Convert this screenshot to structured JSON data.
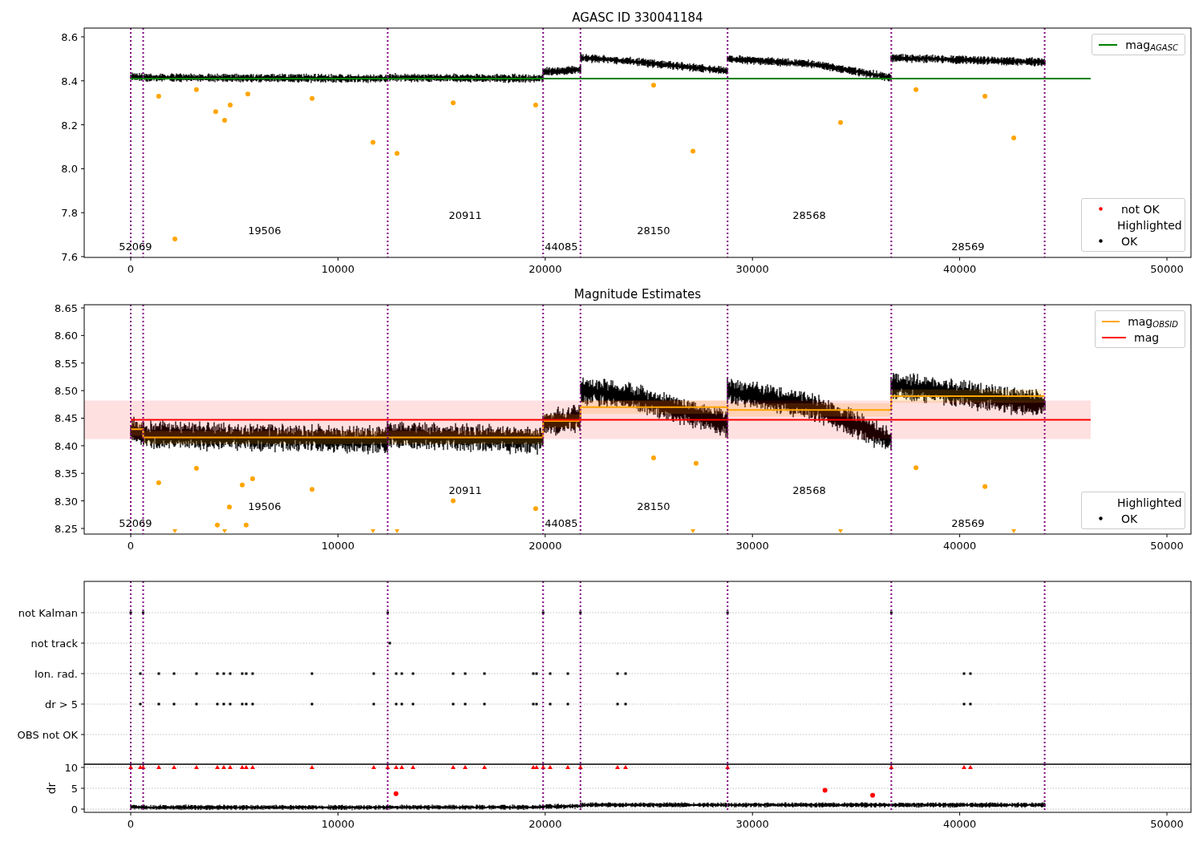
{
  "figure": {
    "panels": [
      {
        "chart_data": {
          "type": "scatter",
          "title": "AGASC ID 330041184",
          "xlim": [
            -2245,
            51160
          ],
          "ylim": [
            7.5964,
            8.64
          ],
          "xticks": [
            0,
            10000,
            20000,
            30000,
            40000,
            50000
          ],
          "yticks": [
            {
              "value": 7.6,
              "label": "7.6"
            },
            {
              "value": 7.8,
              "label": "7.8"
            },
            {
              "value": 8.0,
              "label": "8.0"
            },
            {
              "value": 8.2,
              "label": "8.2"
            },
            {
              "value": 8.4,
              "label": "8.4"
            },
            {
              "value": 8.6,
              "label": "8.6"
            }
          ],
          "series": [
            {
              "name": "mag$_{AGASC}$",
              "type": "line",
              "color": "#008000",
              "x": [
                0,
                46320
              ],
              "values": [
                8.41,
                8.41
              ]
            },
            {
              "name": "not OK",
              "type": "scatter",
              "color": "#ff0000"
            },
            {
              "name": "Highlighted",
              "type": "scatter",
              "color": "#ffa500",
              "x": [
                2130,
                4100,
                4530,
                4800,
                5650,
                11690,
                12850,
                15560,
                19540,
                27130,
                34250,
                41220,
                42610,
                1350,
                3170,
                8750,
                25230,
                37890
              ],
              "values": [
                7.68,
                8.26,
                8.22,
                8.29,
                8.34,
                8.12,
                8.07,
                8.3,
                8.29,
                8.08,
                8.21,
                8.33,
                8.14,
                8.33,
                8.36,
                8.32,
                8.38,
                8.36
              ]
            },
            {
              "name": "OK",
              "type": "scatter",
              "color": "#000000"
            }
          ],
          "ref_lines": [
            {
              "axis": "x",
              "value": 0
            },
            {
              "axis": "x",
              "value": 600
            },
            {
              "axis": "x",
              "value": 12400
            },
            {
              "axis": "x",
              "value": 19900
            },
            {
              "axis": "x",
              "value": 21700
            },
            {
              "axis": "x",
              "value": 28800
            },
            {
              "axis": "x",
              "value": 36700
            },
            {
              "axis": "x",
              "value": 44100
            }
          ],
          "annotations": [
            "52069",
            "19506",
            "20911",
            "44085",
            "28150",
            "28568",
            "28569"
          ]
        }
      },
      {
        "chart_data": {
          "type": "scatter",
          "title": "Magnitude Estimates",
          "xlim": [
            -2245,
            51160
          ],
          "ylim": [
            8.2398,
            8.6558
          ],
          "xticks": [
            0,
            10000,
            20000,
            30000,
            40000,
            50000
          ],
          "yticks": [
            {
              "value": 8.25,
              "label": "8.25"
            },
            {
              "value": 8.3,
              "label": "8.30"
            },
            {
              "value": 8.35,
              "label": "8.35"
            },
            {
              "value": 8.4,
              "label": "8.40"
            },
            {
              "value": 8.45,
              "label": "8.45"
            },
            {
              "value": 8.5,
              "label": "8.50"
            },
            {
              "value": 8.55,
              "label": "8.55"
            },
            {
              "value": 8.6,
              "label": "8.60"
            },
            {
              "value": 8.65,
              "label": "8.65"
            }
          ],
          "series": [
            {
              "name": "mag$_{OBSID}$",
              "type": "step",
              "color": "#ffa500",
              "x": [
                0,
                600,
                12400,
                19900,
                21700,
                28800,
                36700,
                44100
              ],
              "values": [
                8.43,
                8.415,
                8.415,
                8.445,
                8.47,
                8.465,
                8.49,
                8.49
              ]
            },
            {
              "name": "mag",
              "type": "line",
              "color": "#ff0000",
              "x": [
                0,
                46320
              ],
              "values": [
                8.447,
                8.447
              ]
            },
            {
              "name": "Highlighted",
              "type": "scatter",
              "color": "#ffa500",
              "x": [
                1350,
                3170,
                5380,
                5880,
                8750,
                15560,
                19540,
                4760,
                4180,
                5570,
                25230,
                27280,
                37890,
                41220
              ],
              "values": [
                8.333,
                8.359,
                8.329,
                8.34,
                8.321,
                8.3,
                8.286,
                8.289,
                8.256,
                8.256,
                8.378,
                8.368,
                8.36,
                8.326
              ]
            },
            {
              "name": "OK",
              "type": "scatter",
              "color": "#000000"
            }
          ],
          "bands": [
            {
              "axis": "y",
              "from": 8.412,
              "to": 8.482,
              "color": "#ff0000"
            }
          ],
          "ref_lines": [
            {
              "axis": "x",
              "value": 0
            },
            {
              "axis": "x",
              "value": 600
            },
            {
              "axis": "x",
              "value": 12400
            },
            {
              "axis": "x",
              "value": 19900
            },
            {
              "axis": "x",
              "value": 21700
            },
            {
              "axis": "x",
              "value": 28800
            },
            {
              "axis": "x",
              "value": 36700
            },
            {
              "axis": "x",
              "value": 44100
            }
          ],
          "annotations": [
            "52069",
            "19506",
            "20911",
            "44085",
            "28150",
            "28568",
            "28569"
          ]
        }
      },
      {
        "flags": [
          "not Kalman",
          "not track",
          "Ion. rad.",
          "dr > 5",
          "OBS not OK"
        ]
      },
      {
        "chart_data": {
          "type": "scatter",
          "grid": true,
          "ylabel": "dr",
          "xlim": [
            -2245,
            51160
          ],
          "ylim": [
            -0.77,
            10.77
          ],
          "xticks": [
            0,
            10000,
            20000,
            30000,
            40000,
            50000
          ],
          "yticks": [
            0,
            5,
            10
          ],
          "series": [
            {
              "color": "#ff0000",
              "x": [
                0,
                464,
                600,
                1354,
                2090,
                3173,
                4180,
                4489,
                4799,
                5379,
                5573,
                5882,
                8746,
                11726,
                12400,
                12810,
                13080,
                13622,
                15557,
                16138,
                17067,
                19427,
                19582,
                19900,
                20240,
                21091,
                21700,
                23491,
                23878,
                28800,
                36700,
                40209,
                40518
              ],
              "values": [
                10,
                10,
                10,
                10,
                10,
                10,
                10,
                10,
                10,
                10,
                10,
                10,
                10,
                10,
                10,
                10,
                10,
                10,
                10,
                10,
                10,
                10,
                10,
                10,
                10,
                10,
                10,
                10,
                10,
                10,
                10,
                10,
                10
              ]
            },
            {
              "color": "#ff0000",
              "x": [
                12800,
                33500,
                35800
              ],
              "values": [
                3.7,
                4.5,
                3.3
              ]
            }
          ],
          "ref_lines": [
            {
              "axis": "x",
              "value": 0
            },
            {
              "axis": "x",
              "value": 600
            },
            {
              "axis": "x",
              "value": 12400
            },
            {
              "axis": "x",
              "value": 19900
            },
            {
              "axis": "x",
              "value": 21700
            },
            {
              "axis": "x",
              "value": 28800
            },
            {
              "axis": "x",
              "value": 36700
            },
            {
              "axis": "x",
              "value": 44100
            }
          ]
        }
      }
    ]
  }
}
